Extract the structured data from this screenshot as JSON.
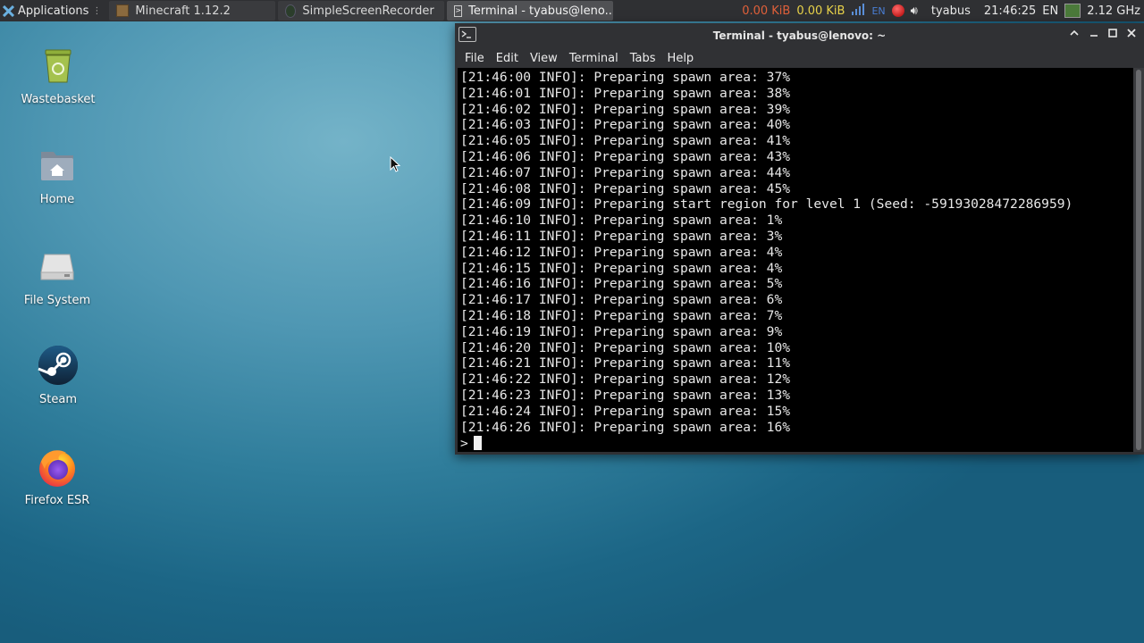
{
  "panel": {
    "applications_label": "Applications",
    "tasks": [
      {
        "label": "Minecraft 1.12.2",
        "icon": "minecraft-icon"
      },
      {
        "label": "SimpleScreenRecorder",
        "icon": "recorder-icon"
      },
      {
        "label": "Terminal - tyabus@leno...",
        "icon": "terminal-icon"
      }
    ],
    "net_down": "0.00 KiB",
    "net_up": "0.00 KiB",
    "keyboard_layout_small": "EN",
    "user": "tyabus",
    "clock": "21:46:25",
    "language": "EN",
    "cpu_freq": "2.12 GHz"
  },
  "desktop_icons": [
    {
      "label": "Wastebasket",
      "icon": "trash-icon"
    },
    {
      "label": "Home",
      "icon": "home-folder-icon"
    },
    {
      "label": "File System",
      "icon": "drive-icon"
    },
    {
      "label": "Steam",
      "icon": "steam-icon"
    },
    {
      "label": "Firefox ESR",
      "icon": "firefox-icon"
    }
  ],
  "terminal": {
    "title": "Terminal - tyabus@lenovo: ~",
    "menu": [
      "File",
      "Edit",
      "View",
      "Terminal",
      "Tabs",
      "Help"
    ],
    "lines": [
      "[21:46:00 INFO]: Preparing spawn area: 37%",
      "[21:46:01 INFO]: Preparing spawn area: 38%",
      "[21:46:02 INFO]: Preparing spawn area: 39%",
      "[21:46:03 INFO]: Preparing spawn area: 40%",
      "[21:46:05 INFO]: Preparing spawn area: 41%",
      "[21:46:06 INFO]: Preparing spawn area: 43%",
      "[21:46:07 INFO]: Preparing spawn area: 44%",
      "[21:46:08 INFO]: Preparing spawn area: 45%",
      "[21:46:09 INFO]: Preparing start region for level 1 (Seed: -59193028472286959)",
      "[21:46:10 INFO]: Preparing spawn area: 1%",
      "[21:46:11 INFO]: Preparing spawn area: 3%",
      "[21:46:12 INFO]: Preparing spawn area: 4%",
      "[21:46:15 INFO]: Preparing spawn area: 4%",
      "[21:46:16 INFO]: Preparing spawn area: 5%",
      "[21:46:17 INFO]: Preparing spawn area: 6%",
      "[21:46:18 INFO]: Preparing spawn area: 7%",
      "[21:46:19 INFO]: Preparing spawn area: 9%",
      "[21:46:20 INFO]: Preparing spawn area: 10%",
      "[21:46:21 INFO]: Preparing spawn area: 11%",
      "[21:46:22 INFO]: Preparing spawn area: 12%",
      "[21:46:23 INFO]: Preparing spawn area: 13%",
      "[21:46:24 INFO]: Preparing spawn area: 15%",
      "[21:46:26 INFO]: Preparing spawn area: 16%"
    ],
    "prompt": ">"
  },
  "colors": {
    "net_down": "#e0603a",
    "net_up": "#e8d24a",
    "keyboard_small": "#4a7fd6"
  }
}
